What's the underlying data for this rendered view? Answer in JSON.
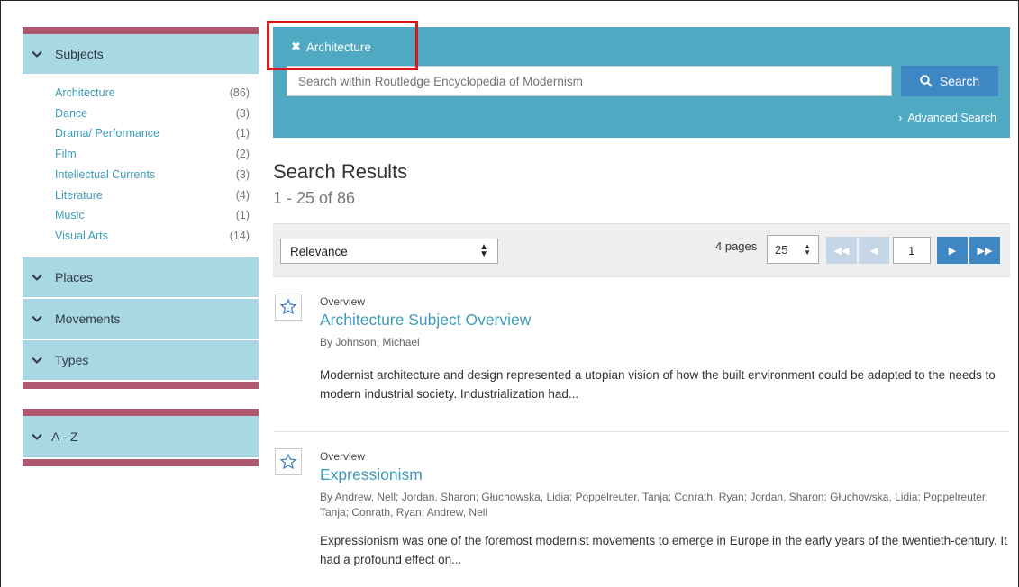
{
  "sidebar": {
    "subjects": {
      "label": "Subjects",
      "items": [
        {
          "label": "Architecture",
          "count": "(86)"
        },
        {
          "label": "Dance",
          "count": "(3)"
        },
        {
          "label": "Drama/ Performance",
          "count": "(1)"
        },
        {
          "label": "Film",
          "count": "(2)"
        },
        {
          "label": "Intellectual Currents",
          "count": "(3)"
        },
        {
          "label": "Literature",
          "count": "(4)"
        },
        {
          "label": "Music",
          "count": "(1)"
        },
        {
          "label": "Visual Arts",
          "count": "(14)"
        }
      ]
    },
    "places_label": "Places",
    "movements_label": "Movements",
    "types_label": "Types",
    "az_label": "A - Z"
  },
  "banner": {
    "active_filter": "Architecture",
    "search_placeholder": "Search within Routledge Encyclopedia of Modernism",
    "search_button": "Search",
    "advanced_search": "Advanced Search"
  },
  "results": {
    "title": "Search Results",
    "count": "1 - 25 of 86",
    "sort_value": "Relevance",
    "pages_label": "4 pages",
    "per_page": "25",
    "current_page": "1",
    "items": [
      {
        "type": "Overview",
        "title": "Architecture Subject Overview",
        "author": "By Johnson, Michael",
        "snippet": "Modernist architecture and design represented a utopian vision of how the built environment could be adapted to the needs to modern industrial society. Industrialization had..."
      },
      {
        "type": "Overview",
        "title": "Expressionism",
        "author": "By Andrew, Nell; Jordan, Sharon; Głuchowska, Lidia; Poppelreuter, Tanja; Conrath, Ryan; Jordan, Sharon; Głuchowska, Lidia; Poppelreuter, Tanja; Conrath, Ryan; Andrew, Nell",
        "snippet": "Expressionism was one of the foremost modernist movements to emerge in Europe in the early years of the twentieth-century. It had a profound effect on..."
      }
    ]
  },
  "colors": {
    "banner": "#4fa9c2",
    "facet": "#a9d8e4",
    "accent_bar": "#b0586f",
    "link": "#3f9bb8",
    "button": "#3f86c5",
    "highlight": "#d7191c"
  },
  "icons": {
    "facet_toggle": "chevron-down-icon",
    "remove_filter": "close-icon",
    "search": "search-icon",
    "advanced": "chevron-right-icon",
    "bookmark": "star-icon"
  }
}
